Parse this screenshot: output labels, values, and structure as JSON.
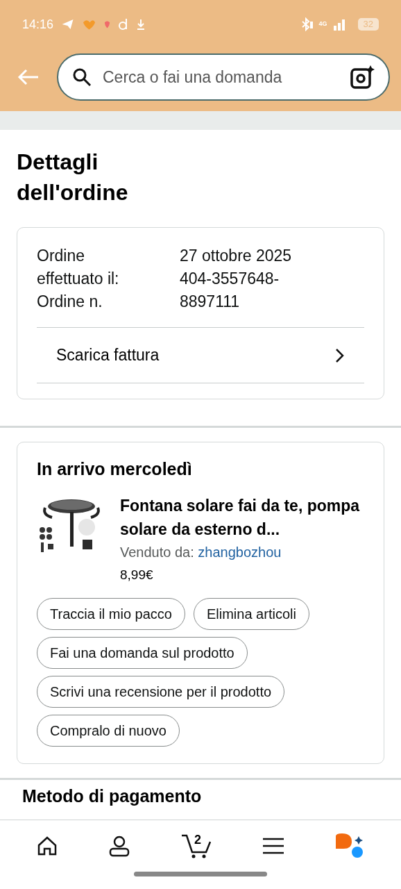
{
  "status_bar": {
    "time": "14:16",
    "network": "4G",
    "battery": "32"
  },
  "search": {
    "placeholder": "Cerca o fai una domanda"
  },
  "title": "Dettagli dell'ordine",
  "order": {
    "labels": [
      "Ordine effettuato il:",
      "Ordine n."
    ],
    "values": [
      "27 ottobre 2025",
      "404-3557648-8897111"
    ],
    "invoice_link": "Scarica fattura"
  },
  "shipment": {
    "heading": "In arrivo mercoledì",
    "product": {
      "title": "Fontana solare fai da te, pompa solare da esterno d...",
      "sold_by_label": "Venduto da:",
      "seller": "zhangbozhou",
      "price": "8,99€"
    },
    "actions": [
      "Traccia il mio pacco",
      "Elimina articoli",
      "Fai una domanda sul prodotto",
      "Scrivi una recensione per il prodotto",
      "Compralo di nuovo"
    ]
  },
  "next_section": "Metodo di pagamento",
  "bottom_nav": {
    "cart_count": "2"
  }
}
